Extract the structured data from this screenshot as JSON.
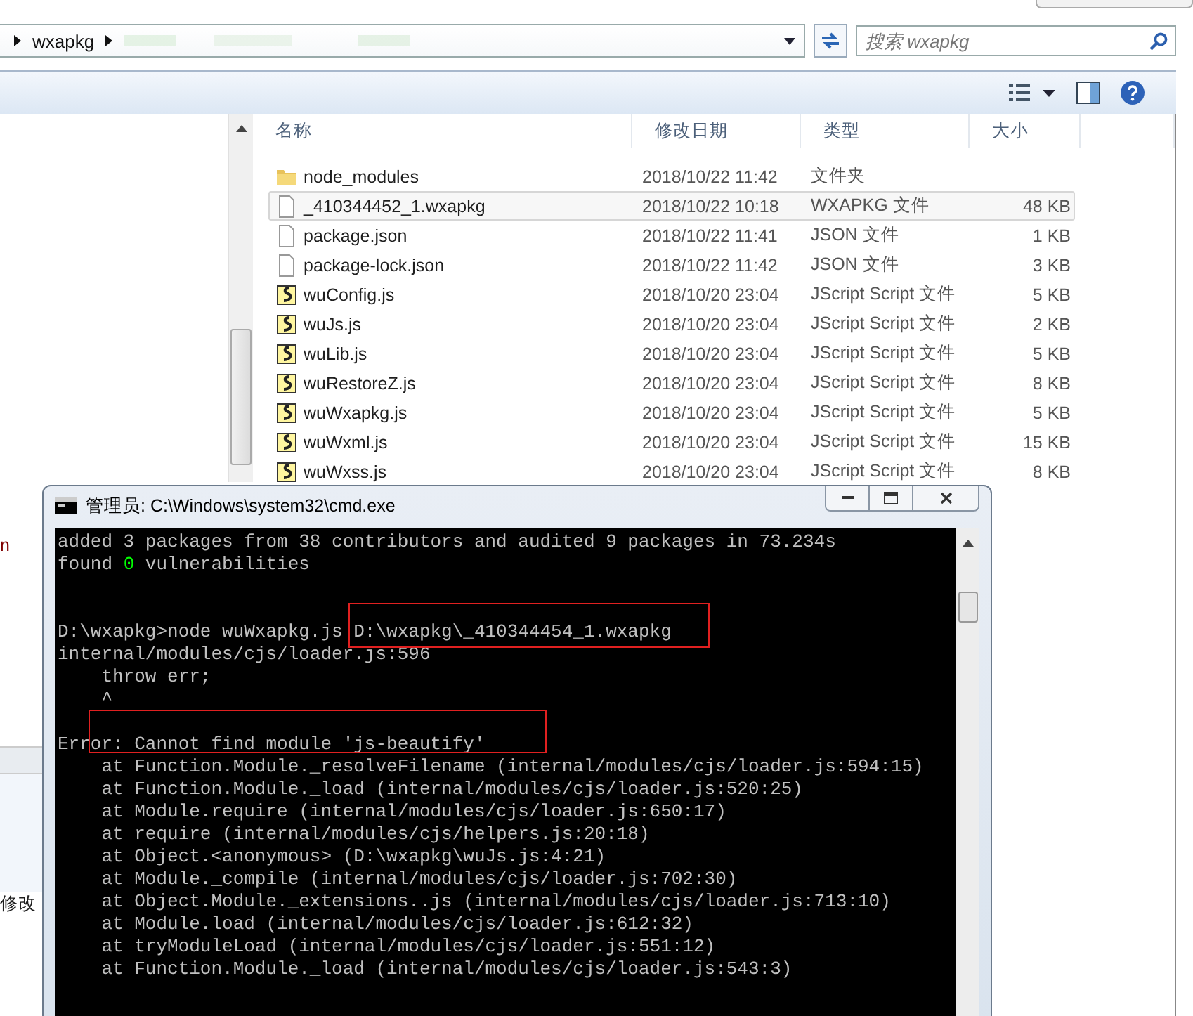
{
  "explorer": {
    "breadcrumb": [
      "wxapkg"
    ],
    "search": {
      "placeholder": "搜索 wxapkg"
    },
    "columns": [
      "名称",
      "修改日期",
      "类型",
      "大小"
    ],
    "files": [
      {
        "kind": "folder",
        "name": "node_modules",
        "date": "2018/10/22 11:42",
        "type": "文件夹",
        "selected": false
      },
      {
        "kind": "file",
        "name": "_410344452_1.wxapkg",
        "date": "2018/10/22 10:18",
        "type": "WXAPKG 文件",
        "size": "48 KB",
        "selected": true
      },
      {
        "kind": "file",
        "name": "package.json",
        "date": "2018/10/22 11:41",
        "type": "JSON 文件",
        "size": "1 KB",
        "selected": false
      },
      {
        "kind": "file",
        "name": "package-lock.json",
        "date": "2018/10/22 11:42",
        "type": "JSON 文件",
        "size": "3 KB",
        "selected": false
      },
      {
        "kind": "script",
        "name": "wuConfig.js",
        "date": "2018/10/20 23:04",
        "type": "JScript Script 文件",
        "size": "5 KB",
        "selected": false
      },
      {
        "kind": "script",
        "name": "wuJs.js",
        "date": "2018/10/20 23:04",
        "type": "JScript Script 文件",
        "size": "2 KB",
        "selected": false
      },
      {
        "kind": "script",
        "name": "wuLib.js",
        "date": "2018/10/20 23:04",
        "type": "JScript Script 文件",
        "size": "5 KB",
        "selected": false
      },
      {
        "kind": "script",
        "name": "wuRestoreZ.js",
        "date": "2018/10/20 23:04",
        "type": "JScript Script 文件",
        "size": "8 KB",
        "selected": false
      },
      {
        "kind": "script",
        "name": "wuWxapkg.js",
        "date": "2018/10/20 23:04",
        "type": "JScript Script 文件",
        "size": "5 KB",
        "selected": false
      },
      {
        "kind": "script",
        "name": "wuWxml.js",
        "date": "2018/10/20 23:04",
        "type": "JScript Script 文件",
        "size": "15 KB",
        "selected": false
      },
      {
        "kind": "script",
        "name": "wuWxss.js",
        "date": "2018/10/20 23:04",
        "type": "JScript Script 文件",
        "size": "8 KB",
        "selected": false
      }
    ],
    "left_fragments": [
      "n",
      "修改"
    ]
  },
  "console": {
    "title": "管理员: C:\\Windows\\system32\\cmd.exe",
    "lines": [
      {
        "text": "added 3 packages from 38 contributors and audited 9 packages in 73.234s"
      },
      {
        "text": "found **0** vulnerabilities"
      },
      {
        "text": "D:\\wxapkg>node wuWxapkg.js D:\\wxapkg\\_410344454_1.wxapkg",
        "kind": "prompt"
      },
      {
        "text": "internal/modules/cjs/loader.js:596"
      },
      {
        "text": "    throw err;"
      },
      {
        "text": "    ^"
      },
      {
        "text": "Error: Cannot find module 'js-beautify'",
        "kind": "error"
      },
      {
        "text": "    at Function.Module._resolveFilename (internal/modules/cjs/loader.js:594:15)"
      },
      {
        "text": "    at Function.Module._load (internal/modules/cjs/loader.js:520:25)"
      },
      {
        "text": "    at Module.require (internal/modules/cjs/loader.js:650:17)"
      },
      {
        "text": "    at require (internal/modules/cjs/helpers.js:20:18)"
      },
      {
        "text": "    at Object.<anonymous> (D:\\wxapkg\\wuJs.js:4:21)"
      },
      {
        "text": "    at Module._compile (internal/modules/cjs/loader.js:702:30)"
      },
      {
        "text": "    at Object.Module._extensions..js (internal/modules/cjs/loader.js:713:10)"
      },
      {
        "text": "    at Module.load (internal/modules/cjs/loader.js:612:32)"
      },
      {
        "text": "    at tryModuleLoad (internal/modules/cjs/loader.js:551:12)"
      },
      {
        "text": "    at Function.Module._load (internal/modules/cjs/loader.js:543:3)"
      }
    ]
  }
}
